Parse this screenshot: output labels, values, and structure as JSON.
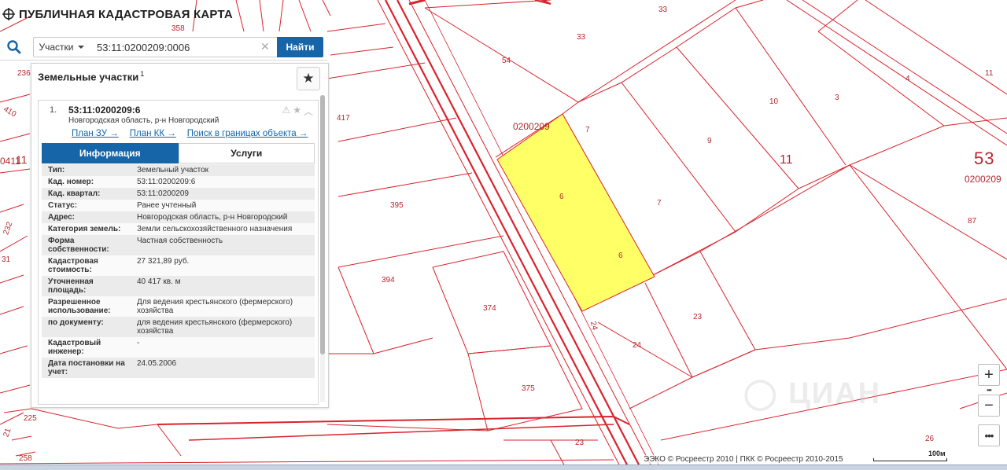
{
  "app": {
    "title": "ПУБЛИЧНАЯ КАДАСТРОВАЯ КАРТА"
  },
  "search": {
    "type_label": "Участки",
    "query": "53:11:0200209:0006",
    "find_label": "Найти"
  },
  "panel": {
    "title": "Земельные участки",
    "count": "1",
    "result": {
      "index": "1.",
      "number": "53:11:0200209:6",
      "region": "Новгородская область, р-н Новгородский",
      "links": [
        "План ЗУ →",
        "План КК →",
        "Поиск в границах объекта →"
      ],
      "tabs": [
        "Информация",
        "Услуги"
      ],
      "fields": [
        {
          "key": "Тип:",
          "value": "Земельный участок"
        },
        {
          "key": "Кад. номер:",
          "value": "53:11:0200209:6"
        },
        {
          "key": "Кад. квартал:",
          "value": "53:11:0200209"
        },
        {
          "key": "Статус:",
          "value": "Ранее учтенный"
        },
        {
          "key": "Адрес:",
          "value": "Новгородская область, р-н Новгородский"
        },
        {
          "key": "Категория земель:",
          "value": "Земли сельскохозяйственного назначения"
        },
        {
          "key": "Форма собственности:",
          "value": "Частная собственность"
        },
        {
          "key": "Кадастровая стоимость:",
          "value": "27 321,89 руб."
        },
        {
          "key": "Уточненная площадь:",
          "value": "40 417 кв. м"
        },
        {
          "key": "Разрешенное использование:",
          "value": "Для ведения крестьянского (фермерского) хозяйства"
        },
        {
          "key": "по документу:",
          "value": "для ведения крестьянского (фермерского) хозяйства"
        },
        {
          "key": "Кадастровый инженер:",
          "value": "-"
        },
        {
          "key": "Дата постановки на учет:",
          "value": "24.05.2006"
        }
      ]
    }
  },
  "map": {
    "parcel_labels": [
      "33",
      "33",
      "54",
      "4",
      "11",
      "10",
      "3",
      "0200209",
      "7",
      "9",
      "11",
      "53",
      "0200209",
      "417",
      "6",
      "7",
      "395",
      "6",
      "87",
      "394",
      "374",
      "24",
      "23",
      "24",
      "375",
      "23",
      "26",
      "225",
      "258",
      "410",
      "236",
      "358",
      "232",
      "31",
      "21",
      "11",
      "0411"
    ],
    "highlight_color": "#ffff66",
    "line_color": "#d9232d",
    "attribution": "ЭЭКО © Росреестр 2010 | ПКК © Росреестр 2010-2015",
    "scale": "100м",
    "zoom_in": "+",
    "zoom_out": "−",
    "more": "•••"
  }
}
